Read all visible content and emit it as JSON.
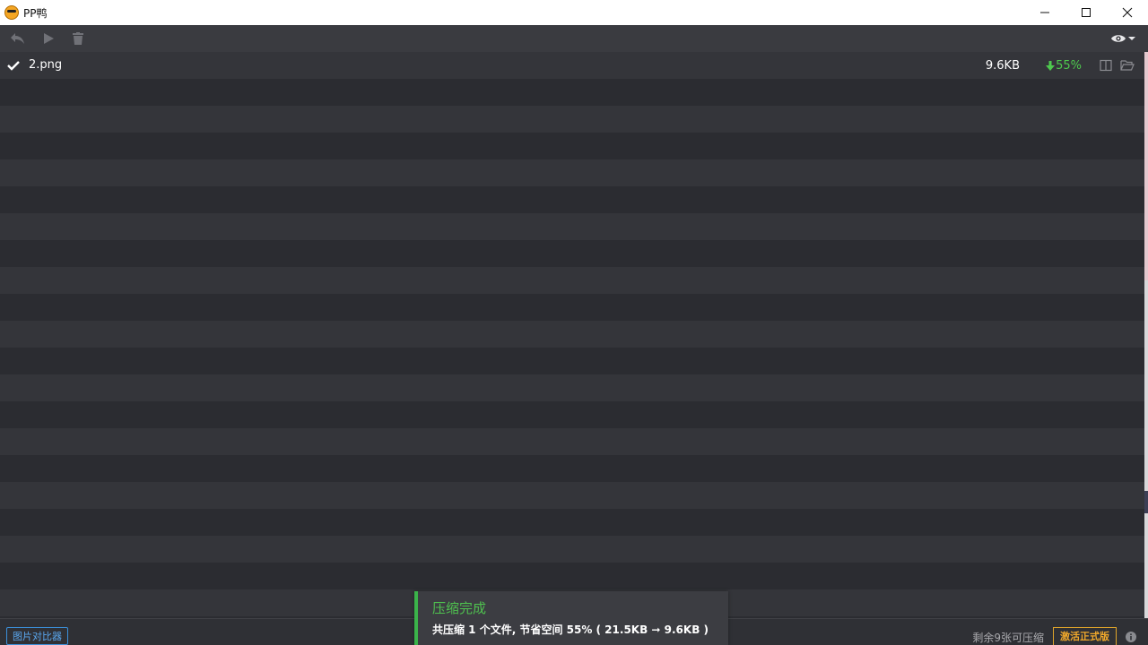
{
  "window": {
    "title": "PP鸭",
    "controls": {
      "minimize": "minimize-icon",
      "maximize": "maximize-icon",
      "close": "close-icon"
    }
  },
  "toolbar": {
    "buttons": [
      "undo-icon",
      "play-icon",
      "trash-icon"
    ],
    "view_menu": "eye-icon"
  },
  "files": [
    {
      "name": "2.png",
      "size": "9.6KB",
      "saving": "55%",
      "status": "done"
    }
  ],
  "toast": {
    "title": "压缩完成",
    "message": "共压缩 1 个文件, 节省空间 55% ( 21.5KB ➞ 9.6KB )"
  },
  "statusbar": {
    "compare_label": "图片对比器",
    "remaining": "剩余9张可压缩",
    "activate_label": "激活正式版"
  },
  "colors": {
    "accent_green": "#4ec94e",
    "accent_blue": "#3b8fd9",
    "accent_orange": "#f0a82b",
    "background": "#2b2c31"
  }
}
